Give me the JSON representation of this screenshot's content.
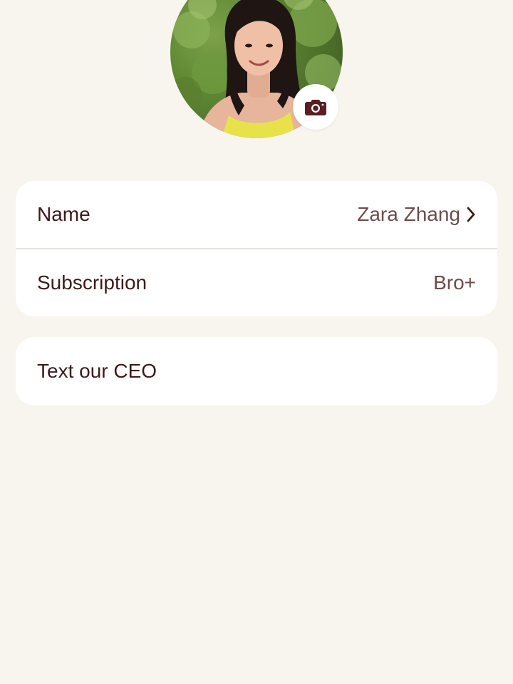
{
  "profile": {
    "avatar_alt": "Profile photo",
    "camera_icon": "camera-icon"
  },
  "rows": {
    "name": {
      "label": "Name",
      "value": "Zara Zhang",
      "icon": "chevron-right-icon"
    },
    "subscription": {
      "label": "Subscription",
      "value": "Bro+"
    }
  },
  "ceo": {
    "label": "Text our CEO"
  },
  "colors": {
    "background": "#f8f5ef",
    "card": "#ffffff",
    "text_primary": "#3d1a1c",
    "text_secondary": "#6e4c4e",
    "divider": "#e6e3df",
    "camera_icon": "#5a1e20"
  }
}
